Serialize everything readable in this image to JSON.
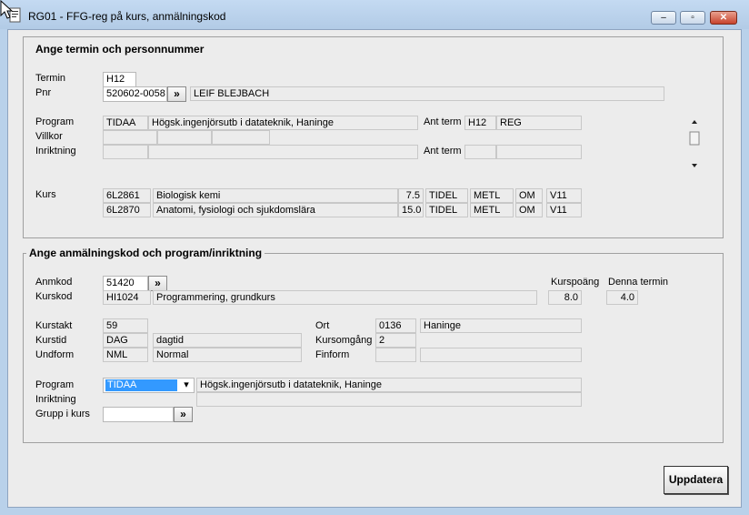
{
  "window": {
    "title": "RG01 - FFG-reg på kurs, anmälningskod",
    "minimize_glyph": "‒",
    "maximize_glyph": "▫",
    "close_glyph": "✕"
  },
  "section1": {
    "heading": "Ange termin och personnummer",
    "termin_label": "Termin",
    "termin_value": "H12",
    "pnr_label": "Pnr",
    "pnr_value": "520602-0058",
    "browse_glyph": "»",
    "name_value": "LEIF BLEJBACH",
    "program_label": "Program",
    "program_code": "TIDAA",
    "program_name": "Högsk.ingenjörsutb i datateknik, Haninge",
    "villkor_label": "Villkor",
    "inriktning_label": "Inriktning",
    "ant_term_label": "Ant term",
    "ant_term_1": "H12",
    "ant_term_1_status": "REG",
    "ant_term_2_label": "Ant term",
    "kurs_label": "Kurs",
    "courses": [
      {
        "code": "6L2861",
        "name": "Biologisk kemi",
        "credits": "7.5",
        "c1": "TIDEL",
        "c2": "METL",
        "c3": "OM",
        "c4": "V11"
      },
      {
        "code": "6L2870",
        "name": "Anatomi, fysiologi och sjukdomslära",
        "credits": "15.0",
        "c1": "TIDEL",
        "c2": "METL",
        "c3": "OM",
        "c4": "V11"
      }
    ]
  },
  "section2": {
    "heading": "Ange anmälningskod och program/inriktning",
    "anmkod_label": "Anmkod",
    "anmkod_value": "51420",
    "browse_glyph": "»",
    "kurspoang_label": "Kurspoäng",
    "denna_termin_label": "Denna termin",
    "kurskod_label": "Kurskod",
    "kurskod_value": "HI1024",
    "kurs_name": "Programmering, grundkurs",
    "kurspoang_value": "8.0",
    "denna_termin_value": "4.0",
    "kurstakt_label": "Kurstakt",
    "kurstakt_value": "59",
    "kurstid_label": "Kurstid",
    "kurstid_code": "DAG",
    "kurstid_text": "dagtid",
    "undform_label": "Undform",
    "undform_code": "NML",
    "undform_text": "Normal",
    "ort_label": "Ort",
    "ort_code": "0136",
    "ort_name": "Haninge",
    "kursomgang_label": "Kursomgång",
    "kursomgang_value": "2",
    "finform_label": "Finform",
    "program_label": "Program",
    "program_selected": "TIDAA",
    "dropdown_glyph": "▾",
    "program_name": "Högsk.ingenjörsutb i datateknik, Haninge",
    "inriktning_label": "Inriktning",
    "grupp_label": "Grupp i kurs",
    "grupp_value": ""
  },
  "actions": {
    "update_label": "Uppdatera"
  },
  "colors": {
    "titlebar": "#c4daf2",
    "client_bg": "#ececec",
    "selection": "#3399ff"
  },
  "icons": [
    "app-icon",
    "mouse-cursor-icon",
    "minimize-icon",
    "maximize-icon",
    "close-icon",
    "chevron-double-right-icon",
    "dropdown-arrow-icon",
    "scroll-up-icon",
    "scroll-down-icon"
  ]
}
